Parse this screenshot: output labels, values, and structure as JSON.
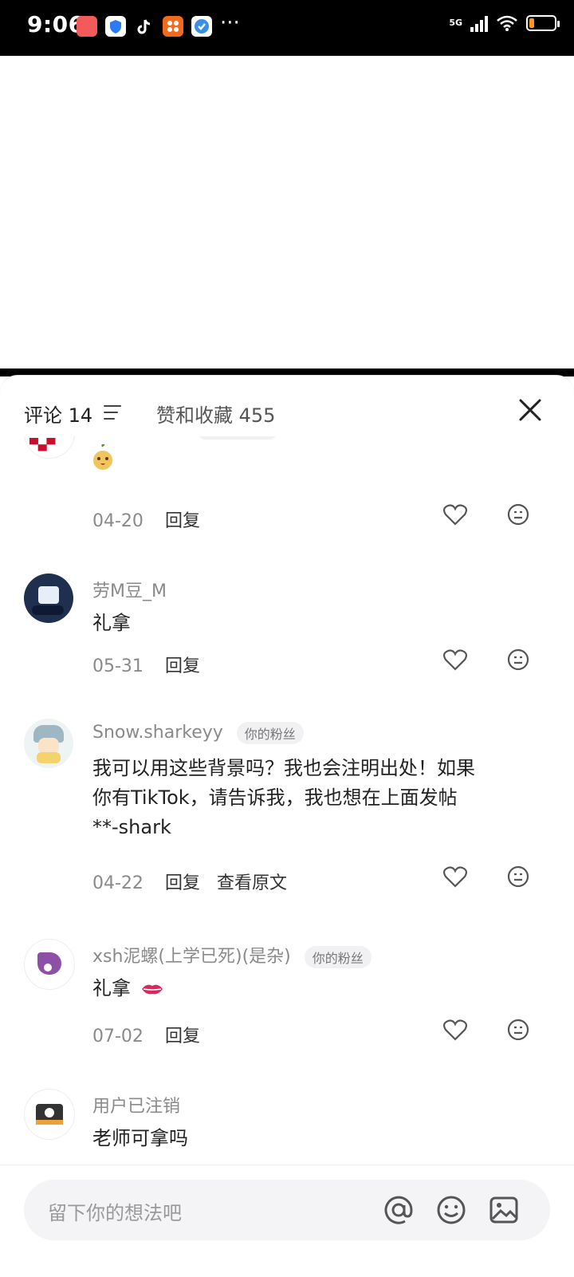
{
  "status_bar": {
    "time": "9:06",
    "network": "5G",
    "more": "···"
  },
  "tabs": {
    "comments_label": "评论 14",
    "likes_label": "赞和收藏 455"
  },
  "comments": [
    {
      "date": "04-20",
      "reply": "回复"
    },
    {
      "username": "劳M豆_M",
      "text": "礼拿",
      "date": "05-31",
      "reply": "回复"
    },
    {
      "username": "Snow.sharkeyy",
      "badge": "你的粉丝",
      "text_line1": "我可以用这些背景吗？我也会注明出处！如果",
      "text_line2": "你有TikTok，请告诉我，我也想在上面发帖",
      "text_line3": "**-shark",
      "date": "04-22",
      "reply": "回复",
      "view_original": "查看原文"
    },
    {
      "username": "xsh泥螺(上学已死)(是杂)",
      "badge": "你的粉丝",
      "text": "礼拿",
      "date": "07-02",
      "reply": "回复"
    },
    {
      "username": "用户已注销",
      "text": "老师可拿吗"
    }
  ],
  "input": {
    "placeholder": "留下你的想法吧"
  },
  "colors": {
    "battery": "#f59a23",
    "lips": "#e0245e",
    "background": "#ffffff"
  }
}
